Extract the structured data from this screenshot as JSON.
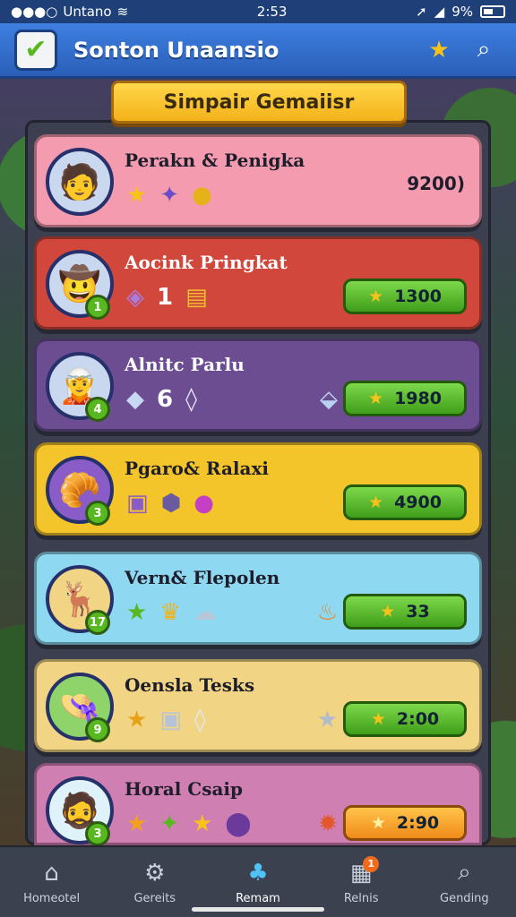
{
  "status_bar": {
    "carrier": "Untano",
    "time": "2:53",
    "battery": "9%"
  },
  "header": {
    "title": "Sonton Unaansio"
  },
  "banner": {
    "title": "Simpair Gemaiisr"
  },
  "cards": [
    {
      "name": "Perakn & Penigka",
      "color": "#f49bb0",
      "level": "",
      "score": "9200)",
      "items": [
        "star-icon",
        "potion-icon",
        "coin-icon"
      ]
    },
    {
      "name": "Aocink Pringkat",
      "color": "#d1473c",
      "level": "1",
      "count": "1",
      "score": "1300",
      "items": [
        "rune-icon",
        "coin-stack-icon"
      ]
    },
    {
      "name": "Alnitc Parlu",
      "color": "#6c4d92",
      "level": "4",
      "count": "6",
      "score": "1980",
      "items": [
        "crystal-icon",
        "gem-icon"
      ]
    },
    {
      "name": "Pgaro& Ralaxi",
      "color": "#f4c52a",
      "level": "3",
      "score": "4900",
      "items": [
        "chest-icon",
        "bag-icon",
        "orb-icon"
      ]
    },
    {
      "name": "Vern& Flepolen",
      "color": "#8fd8f2",
      "level": "17",
      "score": "33",
      "items": [
        "star-icon",
        "crown-icon",
        "cloud-icon"
      ]
    },
    {
      "name": "Oensla Tesks",
      "color": "#f1d584",
      "level": "9",
      "score": "2:00",
      "items": [
        "star-icon",
        "chest-icon",
        "gem-icon"
      ]
    },
    {
      "name": "Horal Csaip",
      "color": "#d07fb2",
      "level": "3",
      "score": "2:90",
      "items": [
        "star-icon",
        "leaf-star-icon",
        "star-icon",
        "potion-badge-icon"
      ]
    }
  ],
  "tabs": [
    {
      "label": "Homeotel",
      "icon": "home-icon"
    },
    {
      "label": "Gereits",
      "icon": "robot-icon"
    },
    {
      "label": "Remam",
      "icon": "clover-icon"
    },
    {
      "label": "Relnis",
      "icon": "inbox-icon",
      "badge": "1"
    },
    {
      "label": "Gending",
      "icon": "search-icon"
    }
  ]
}
